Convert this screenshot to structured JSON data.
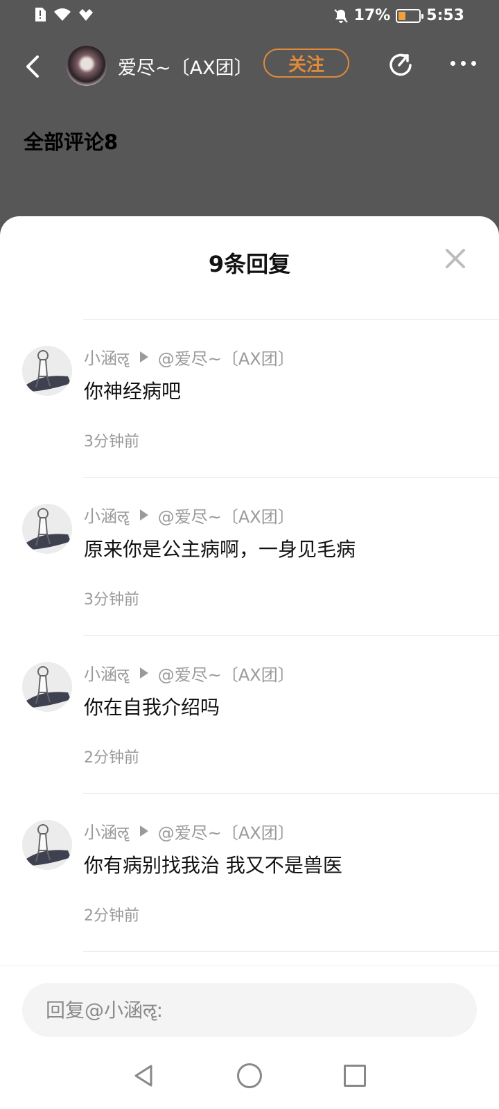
{
  "status_bar": {
    "battery": "17%",
    "time": "5:53"
  },
  "header": {
    "author": "爱尽~〔AX团〕",
    "follow_label": "关注"
  },
  "comments_heading": "全部评论8",
  "sheet": {
    "title": "9条回复"
  },
  "replies": [
    {
      "user": "小涵ॡ",
      "target": "@爱尽~〔AX团〕",
      "text": "你神经病吧",
      "time": "3分钟前"
    },
    {
      "user": "小涵ॡ",
      "target": "@爱尽~〔AX团〕",
      "text": "原来你是公主病啊，一身见毛病",
      "time": "3分钟前"
    },
    {
      "user": "小涵ॡ",
      "target": "@爱尽~〔AX团〕",
      "text": "你在自我介绍吗",
      "time": "2分钟前"
    },
    {
      "user": "小涵ॡ",
      "target": "@爱尽~〔AX团〕",
      "text": "你有病别找我治 我又不是兽医",
      "time": "2分钟前"
    }
  ],
  "input": {
    "placeholder": "回复@小涵ॡ:"
  },
  "colors": {
    "accent": "#e08a3a",
    "muted": "#9a9a9a"
  },
  "icons": [
    "back-icon",
    "share-icon",
    "more-icon",
    "close-icon",
    "mute-icon",
    "wifi-icon",
    "battery-icon"
  ]
}
